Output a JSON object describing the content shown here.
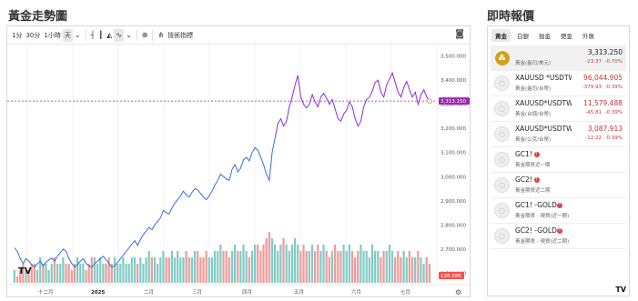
{
  "chart_panel": {
    "title": "黃金走勢圖"
  },
  "quote_panel": {
    "title": "即時報價"
  },
  "toolbar": {
    "intervals": [
      "1分",
      "30分",
      "1小時",
      "天"
    ],
    "active_interval": "天",
    "indicators_label": "技術指標"
  },
  "tabs": [
    "黃金",
    "白銀",
    "鉑金",
    "鈀金",
    "外匯"
  ],
  "active_tab": "黃金",
  "quotes": [
    {
      "symbol": "",
      "name": "黃金(盎司/美元)",
      "price": "3,313.250",
      "change": "-23.37",
      "pct": "-0.70%",
      "icon": "gold-bars-icon"
    },
    {
      "symbol": "XAUUSD *USDTWI",
      "name": "黃金(盎司/台幣)",
      "price": "96,044.905",
      "change": "-379.93",
      "pct": "-0.39%",
      "icon": "placeholder-icon"
    },
    {
      "symbol": "XAUUSD*USDTWD/",
      "name": "黃金(台錢/台幣)",
      "price": "11,579.488",
      "change": "-45.81",
      "pct": "-0.39%",
      "icon": "placeholder-icon"
    },
    {
      "symbol": "XAUUSD*USDTWD/",
      "name": "黃金(公克/台幣)",
      "price": "3,087.913",
      "change": "-12.22",
      "pct": "-0.39%",
      "icon": "placeholder-icon"
    },
    {
      "symbol": "GC1!",
      "name": "黃金期貨近一期",
      "price": "",
      "change": "",
      "pct": "",
      "icon": "placeholder-icon",
      "alert": true
    },
    {
      "symbol": "GC2!",
      "name": "黃金期貨近二期",
      "price": "",
      "change": "",
      "pct": "",
      "icon": "placeholder-icon",
      "alert": true
    },
    {
      "symbol": "GC1! -GOLD",
      "name": "黃金期貨 - 現貨(近一期)",
      "price": "",
      "change": "",
      "pct": "",
      "icon": "placeholder-icon",
      "alert": true
    },
    {
      "symbol": "GC2! -GOLD",
      "name": "黃金期貨 - 現貨(近二期)",
      "price": "",
      "change": "",
      "pct": "",
      "icon": "placeholder-icon",
      "alert": true
    }
  ],
  "colors": {
    "line_early": "#2f6fd4",
    "line_late": "#8a2be2",
    "vol_up": "#80cbc4",
    "vol_down": "#ef9a9a",
    "price_label": "#9c27b0",
    "vol_label": "#ef5350",
    "down": "#cc3333"
  },
  "chart_data": {
    "type": "line",
    "x_labels": [
      "十二月",
      "2025",
      "二月",
      "三月",
      "四月",
      "五月",
      "六月",
      "七月"
    ],
    "y_ticks": [
      "3,500.000",
      "3,400.000",
      "3,300.000",
      "3,200.000",
      "3,100.000",
      "3,000.000",
      "2,900.000",
      "2,800.000",
      "2,700.000",
      "2,600.000"
    ],
    "ylim": [
      2560,
      3540
    ],
    "last_price": 3313.25,
    "last_price_label": "3,313.150",
    "volume_label": "126.58K",
    "series": [
      {
        "values": [
          2705,
          2690,
          2660,
          2640,
          2660,
          2650,
          2635,
          2625,
          2640,
          2650,
          2630,
          2645,
          2655,
          2662,
          2650,
          2670,
          2685,
          2700,
          2690,
          2660,
          2640,
          2625,
          2635,
          2650,
          2660,
          2640,
          2630,
          2625,
          2640,
          2650,
          2660,
          2670,
          2655,
          2640,
          2625,
          2630,
          2645,
          2660,
          2675,
          2690,
          2705,
          2720,
          2735,
          2715,
          2740,
          2760,
          2775,
          2790,
          2780,
          2800,
          2815,
          2830,
          2860,
          2850,
          2845,
          2870,
          2890,
          2905,
          2920,
          2940,
          2925,
          2915,
          2935,
          2950,
          2945,
          2930,
          2915,
          2905,
          2920,
          2940,
          2965,
          2985,
          3010,
          3000,
          2990,
          2985,
          3030,
          3050,
          3020,
          3035,
          3070,
          3080,
          3065,
          3100,
          3120,
          3110,
          3080,
          3050,
          3010,
          2985,
          3100,
          3160,
          3220,
          3240,
          3210,
          3230,
          3290,
          3330,
          3380,
          3420,
          3330,
          3300,
          3285,
          3300,
          3340,
          3310,
          3290,
          3330,
          3345,
          3325,
          3300,
          3320,
          3280,
          3240,
          3230,
          3260,
          3275,
          3310,
          3290,
          3240,
          3210,
          3230,
          3290,
          3320,
          3330,
          3355,
          3390,
          3400,
          3350,
          3330,
          3380,
          3405,
          3430,
          3390,
          3350,
          3330,
          3370,
          3395,
          3360,
          3330,
          3350,
          3300,
          3340,
          3360,
          3330,
          3313
        ]
      }
    ],
    "volume": [
      2,
      1,
      2,
      3,
      2,
      2,
      3,
      3,
      2,
      4,
      3,
      3,
      2,
      3,
      4,
      3,
      3,
      4,
      3,
      3,
      2,
      3,
      4,
      3,
      3,
      2,
      3,
      4,
      4,
      3,
      4,
      3,
      3,
      4,
      3,
      4,
      3,
      3,
      4,
      3,
      3,
      4,
      4,
      3,
      4,
      3,
      4,
      5,
      4,
      4,
      3,
      4,
      5,
      4,
      4,
      5,
      4,
      5,
      4,
      4,
      5,
      4,
      4,
      5,
      5,
      4,
      4,
      5,
      4,
      4,
      5,
      5,
      6,
      5,
      5,
      4,
      5,
      6,
      5,
      5,
      6,
      5,
      4,
      5,
      6,
      6,
      5,
      6,
      7,
      8,
      7,
      6,
      5,
      6,
      7,
      6,
      5,
      6,
      7,
      6,
      5,
      6,
      5,
      5,
      6,
      5,
      6,
      5,
      6,
      5,
      4,
      5,
      6,
      5,
      5,
      6,
      5,
      6,
      5,
      4,
      5,
      6,
      5,
      5,
      4,
      6,
      5,
      5,
      4,
      5,
      5,
      6,
      5,
      4,
      5,
      4,
      5,
      4,
      5,
      4,
      4,
      5,
      4,
      3,
      4,
      3,
      4,
      3,
      2,
      1
    ]
  }
}
